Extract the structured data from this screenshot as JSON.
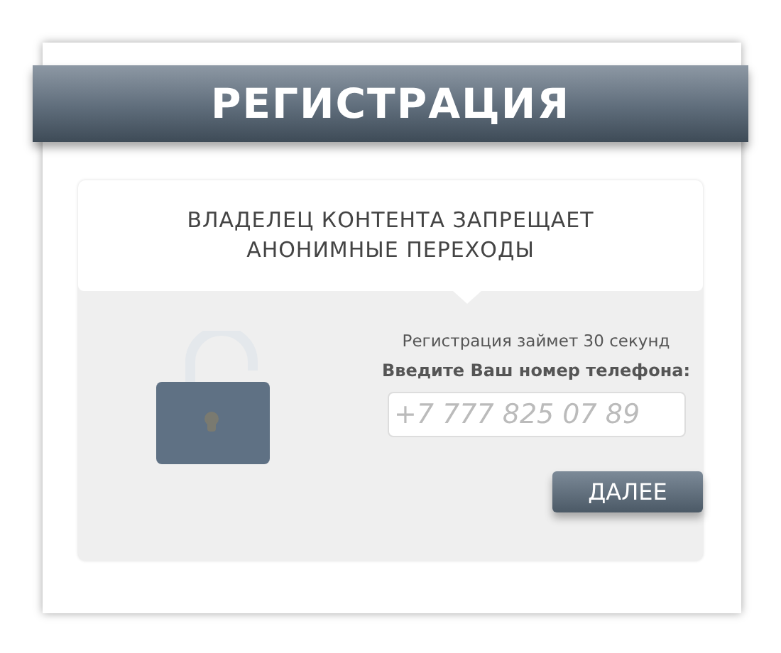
{
  "banner": {
    "title": "РЕГИСТРАЦИЯ"
  },
  "notice": {
    "text": "ВЛАДЕЛЕЦ КОНТЕНТА ЗАПРЕЩАЕТ АНОНИМНЫЕ ПЕРЕХОДЫ"
  },
  "form": {
    "hint": "Регистрация займет 30 секунд",
    "label": "Введите Ваш номер телефона:",
    "phone": {
      "placeholder": "+7 777 825 07 89"
    },
    "submit": "ДАЛЕЕ"
  }
}
